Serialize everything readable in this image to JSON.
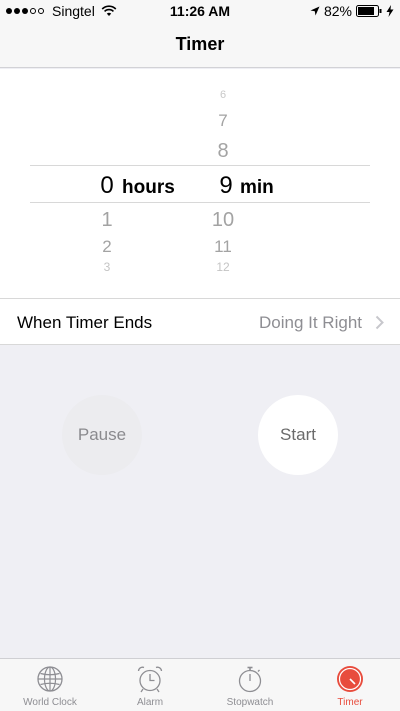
{
  "status_bar": {
    "carrier": "Singtel",
    "time": "11:26 AM",
    "battery": "82%",
    "signal_bars_filled": 3,
    "signal_bars_total": 5
  },
  "nav": {
    "title": "Timer"
  },
  "picker": {
    "hours": {
      "above": [
        "",
        "",
        ""
      ],
      "selected": "0",
      "unit": "hours",
      "below": [
        "1",
        "2",
        "3"
      ]
    },
    "minutes": {
      "above": [
        "6",
        "7",
        "8"
      ],
      "selected": "9",
      "unit": "min",
      "below": [
        "10",
        "11",
        "12"
      ]
    }
  },
  "when_timer_ends": {
    "label": "When Timer Ends",
    "value": "Doing It Right"
  },
  "buttons": {
    "pause": "Pause",
    "start": "Start"
  },
  "tabs": [
    {
      "label": "World Clock",
      "icon": "globe-icon",
      "active": false
    },
    {
      "label": "Alarm",
      "icon": "alarm-clock-icon",
      "active": false
    },
    {
      "label": "Stopwatch",
      "icon": "stopwatch-icon",
      "active": false
    },
    {
      "label": "Timer",
      "icon": "timer-icon",
      "active": true
    }
  ],
  "colors": {
    "accent": "#e84c3d",
    "background": "#efeff4"
  }
}
